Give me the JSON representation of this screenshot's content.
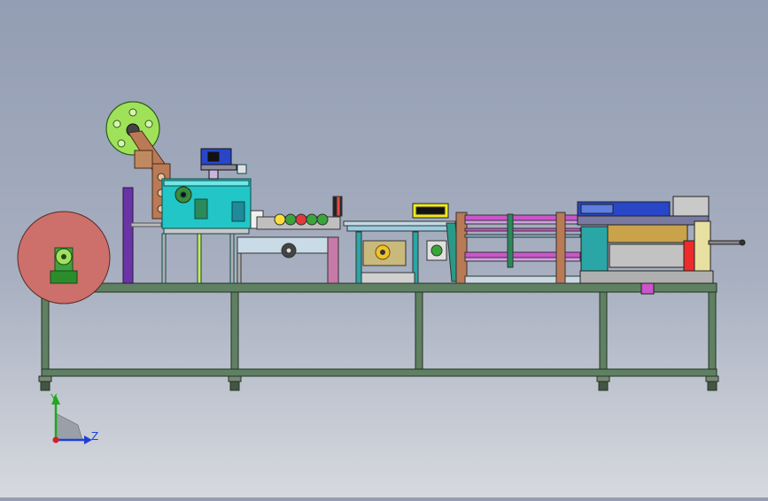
{
  "view": {
    "type": "CAD 3D model viewport (side elevation of production line machine)",
    "axis_triad": {
      "y_label": "Y",
      "z_label": "Z"
    }
  },
  "colors": {
    "frame": "#5a7a5a",
    "frame_edge": "#223322",
    "unwind_roll": "#cd6f6a",
    "reel": "#9fe25a",
    "body_cyan": "#22c6c6",
    "brown": "#b97a55",
    "magenta": "#cc55cc",
    "yellow": "#e8e500",
    "blue": "#2846c8",
    "red": "#ee2b2b",
    "gold": "#c9a24a",
    "axis_y": "#1fa81f",
    "axis_z": "#1f3fd8",
    "axis_origin": "#d62020"
  }
}
